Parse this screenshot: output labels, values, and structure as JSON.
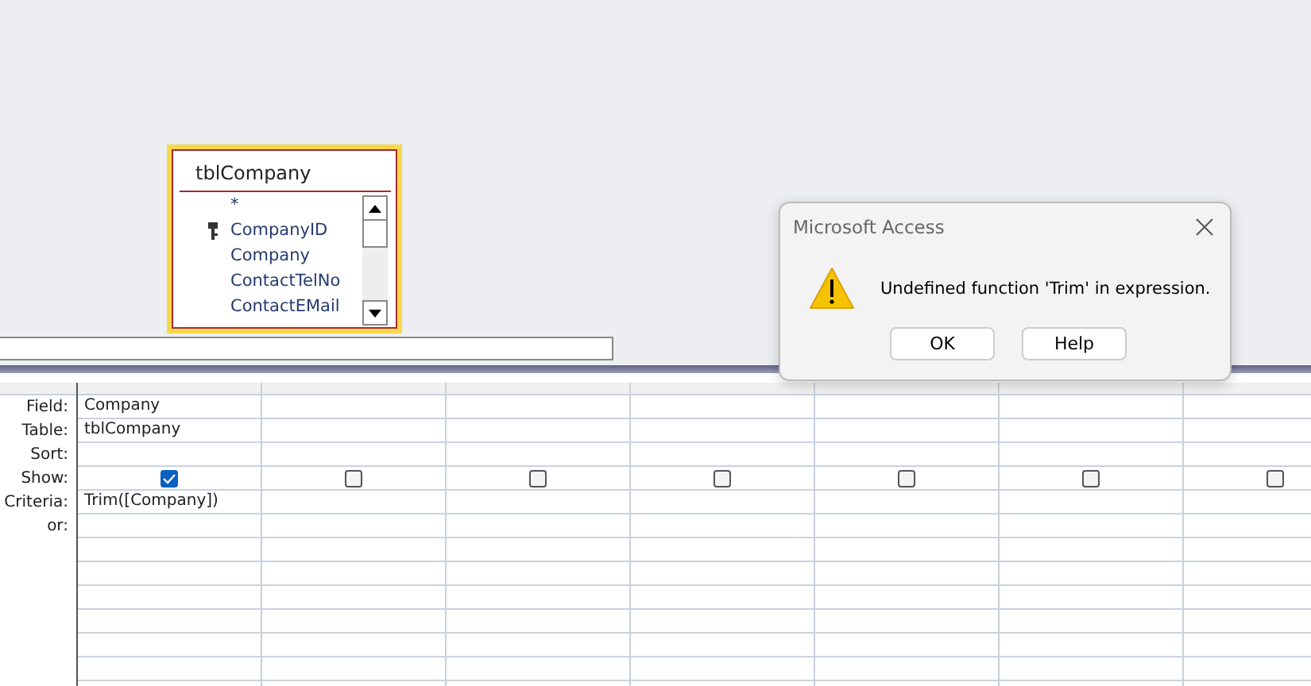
{
  "table_box": {
    "title": "tblCompany",
    "fields": [
      {
        "name": "*",
        "key": false
      },
      {
        "name": "CompanyID",
        "key": true
      },
      {
        "name": "Company",
        "key": false
      },
      {
        "name": "ContactTelNo",
        "key": false
      },
      {
        "name": "ContactEMail",
        "key": false
      }
    ]
  },
  "grid": {
    "row_labels": [
      "Field:",
      "Table:",
      "Sort:",
      "Show:",
      "Criteria:",
      "or:"
    ],
    "columns": [
      {
        "field": "Company",
        "table": "tblCompany",
        "show": true,
        "criteria": "Trim([Company])"
      },
      {
        "show": false
      },
      {
        "show": false
      },
      {
        "show": false
      },
      {
        "show": false
      },
      {
        "show": false
      },
      {
        "show": false
      }
    ]
  },
  "dialog": {
    "title": "Microsoft Access",
    "message": "Undefined function 'Trim' in expression.",
    "buttons": [
      "OK",
      "Help"
    ]
  }
}
